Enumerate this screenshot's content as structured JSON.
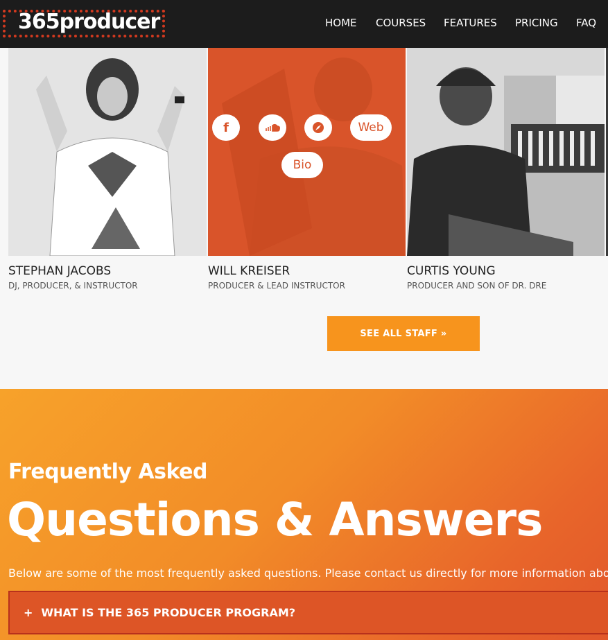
{
  "brand": {
    "logo_text": "365producer",
    "logo_color": "#d2391f"
  },
  "nav": {
    "items": [
      {
        "label": "HOME"
      },
      {
        "label": "COURSES"
      },
      {
        "label": "FEATURES"
      },
      {
        "label": "PRICING"
      },
      {
        "label": "FAQ"
      }
    ]
  },
  "staff": [
    {
      "name": "STEPHAN JACOBS",
      "role": "DJ, PRODUCER, & INSTRUCTOR"
    },
    {
      "name": "WILL KREISER",
      "role": "PRODUCER & LEAD INSTRUCTOR",
      "links": {
        "facebook_icon": "f",
        "soundcloud_icon": "soundcloud-icon",
        "web_label": "Web",
        "bio_label": "Bio"
      }
    },
    {
      "name": "CURTIS YOUNG",
      "role": "PRODUCER AND SON OF DR. DRE"
    }
  ],
  "see_all_label": "SEE ALL STAFF »",
  "faq": {
    "subtitle": "Frequently Asked",
    "title": "Questions & Answers",
    "description": "Below are some of the most frequently asked questions. Please contact us directly for more information abo",
    "questions": [
      {
        "icon": "+",
        "text": "WHAT IS THE 365 PRODUCER PROGRAM?"
      }
    ]
  },
  "colors": {
    "accent_orange": "#f7941d",
    "overlay_orange": "#d9542a",
    "header_bg": "#1c1c1c"
  }
}
